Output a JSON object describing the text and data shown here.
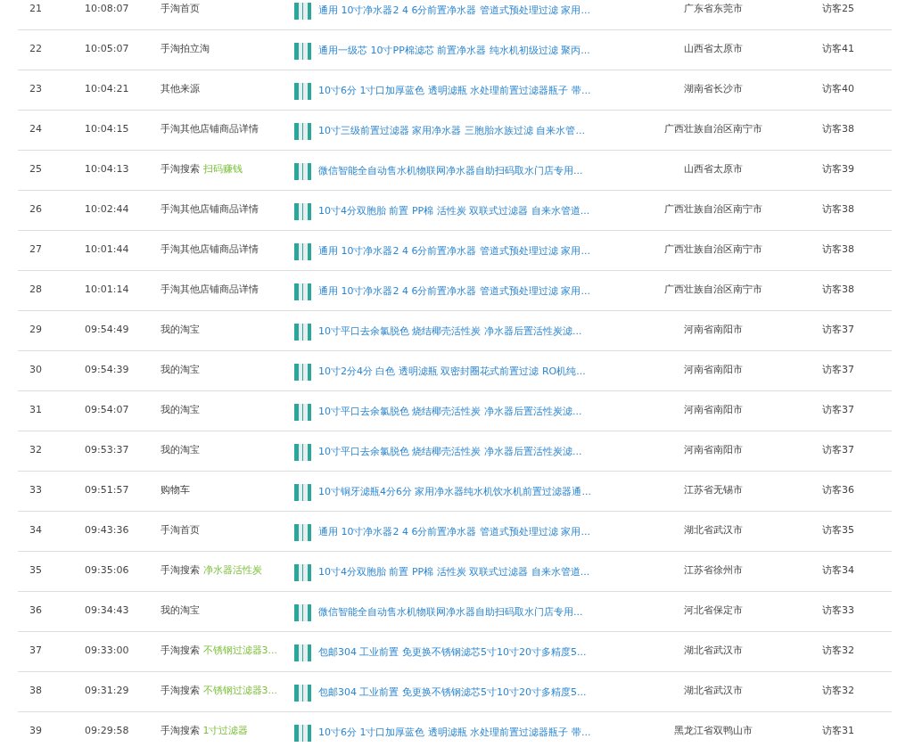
{
  "rows": [
    {
      "index": "21",
      "time": "10:08:07",
      "source": "手淘首页",
      "product": "通用 10寸净水器2 4 6分前置净水器 管道式预处理过滤 家用...",
      "location": "广东省东莞市",
      "visitor": "访客25"
    },
    {
      "index": "22",
      "time": "10:05:07",
      "source": "手淘拍立淘",
      "product": "通用一级芯 10寸PP棉滤芯 前置净水器 纯水机初级过滤 聚丙...",
      "location": "山西省太原市",
      "visitor": "访客41"
    },
    {
      "index": "23",
      "time": "10:04:21",
      "source": "其他来源",
      "product": "10寸6分 1寸口加厚蓝色 透明滤瓶 水处理前置过滤器瓶子 带...",
      "location": "湖南省长沙市",
      "visitor": "访客40"
    },
    {
      "index": "24",
      "time": "10:04:15",
      "source": "手淘其他店铺商品详情",
      "product": "10寸三级前置过滤器 家用净水器 三胞胎水族过滤 自来水管...",
      "location": "广西壮族自治区南宁市",
      "visitor": "访客38"
    },
    {
      "index": "25",
      "time": "10:04:13",
      "source": "手淘搜索",
      "keyword": "扫码赚钱",
      "product": "微信智能全自动售水机物联网净水器自助扫码取水门店专用...",
      "location": "山西省太原市",
      "visitor": "访客39"
    },
    {
      "index": "26",
      "time": "10:02:44",
      "source": "手淘其他店铺商品详情",
      "product": "10寸4分双胞胎 前置 PP棉 活性炭 双联式过滤器 自来水管道...",
      "location": "广西壮族自治区南宁市",
      "visitor": "访客38"
    },
    {
      "index": "27",
      "time": "10:01:44",
      "source": "手淘其他店铺商品详情",
      "product": "通用 10寸净水器2 4 6分前置净水器 管道式预处理过滤 家用...",
      "location": "广西壮族自治区南宁市",
      "visitor": "访客38"
    },
    {
      "index": "28",
      "time": "10:01:14",
      "source": "手淘其他店铺商品详情",
      "product": "通用 10寸净水器2 4 6分前置净水器 管道式预处理过滤 家用...",
      "location": "广西壮族自治区南宁市",
      "visitor": "访客38"
    },
    {
      "index": "29",
      "time": "09:54:49",
      "source": "我的淘宝",
      "product": "10寸平口去余氯脱色 烧结椰壳活性炭 净水器后置活性炭滤...",
      "location": "河南省南阳市",
      "visitor": "访客37"
    },
    {
      "index": "30",
      "time": "09:54:39",
      "source": "我的淘宝",
      "product": "10寸2分4分 白色 透明滤瓶 双密封圈花式前置过滤 RO机纯...",
      "location": "河南省南阳市",
      "visitor": "访客37"
    },
    {
      "index": "31",
      "time": "09:54:07",
      "source": "我的淘宝",
      "product": "10寸平口去余氯脱色 烧结椰壳活性炭 净水器后置活性炭滤...",
      "location": "河南省南阳市",
      "visitor": "访客37"
    },
    {
      "index": "32",
      "time": "09:53:37",
      "source": "我的淘宝",
      "product": "10寸平口去余氯脱色 烧结椰壳活性炭 净水器后置活性炭滤...",
      "location": "河南省南阳市",
      "visitor": "访客37"
    },
    {
      "index": "33",
      "time": "09:51:57",
      "source": "购物车",
      "product": "10寸铜牙滤瓶4分6分 家用净水器纯水机饮水机前置过滤器通...",
      "location": "江苏省无锡市",
      "visitor": "访客36"
    },
    {
      "index": "34",
      "time": "09:43:36",
      "source": "手淘首页",
      "product": "通用 10寸净水器2 4 6分前置净水器 管道式预处理过滤 家用...",
      "location": "湖北省武汉市",
      "visitor": "访客35"
    },
    {
      "index": "35",
      "time": "09:35:06",
      "source": "手淘搜索",
      "keyword": "净水器活性炭",
      "product": "10寸4分双胞胎 前置 PP棉 活性炭 双联式过滤器 自来水管道...",
      "location": "江苏省徐州市",
      "visitor": "访客34"
    },
    {
      "index": "36",
      "time": "09:34:43",
      "source": "我的淘宝",
      "product": "微信智能全自动售水机物联网净水器自助扫码取水门店专用...",
      "location": "河北省保定市",
      "visitor": "访客33"
    },
    {
      "index": "37",
      "time": "09:33:00",
      "source": "手淘搜索",
      "keyword": "不锈钢过滤器3...",
      "product": "包邮304 工业前置 免更换不锈钢滤芯5寸10寸20寸多精度5...",
      "location": "湖北省武汉市",
      "visitor": "访客32"
    },
    {
      "index": "38",
      "time": "09:31:29",
      "source": "手淘搜索",
      "keyword": "不锈钢过滤器3...",
      "product": "包邮304 工业前置 免更换不锈钢滤芯5寸10寸20寸多精度5...",
      "location": "湖北省武汉市",
      "visitor": "访客32"
    },
    {
      "index": "39",
      "time": "09:29:58",
      "source": "手淘搜索",
      "keyword": "1寸过滤器",
      "product": "10寸6分 1寸口加厚蓝色 透明滤瓶 水处理前置过滤器瓶子 带...",
      "location": "黑龙江省双鸭山市",
      "visitor": "访客31"
    }
  ]
}
